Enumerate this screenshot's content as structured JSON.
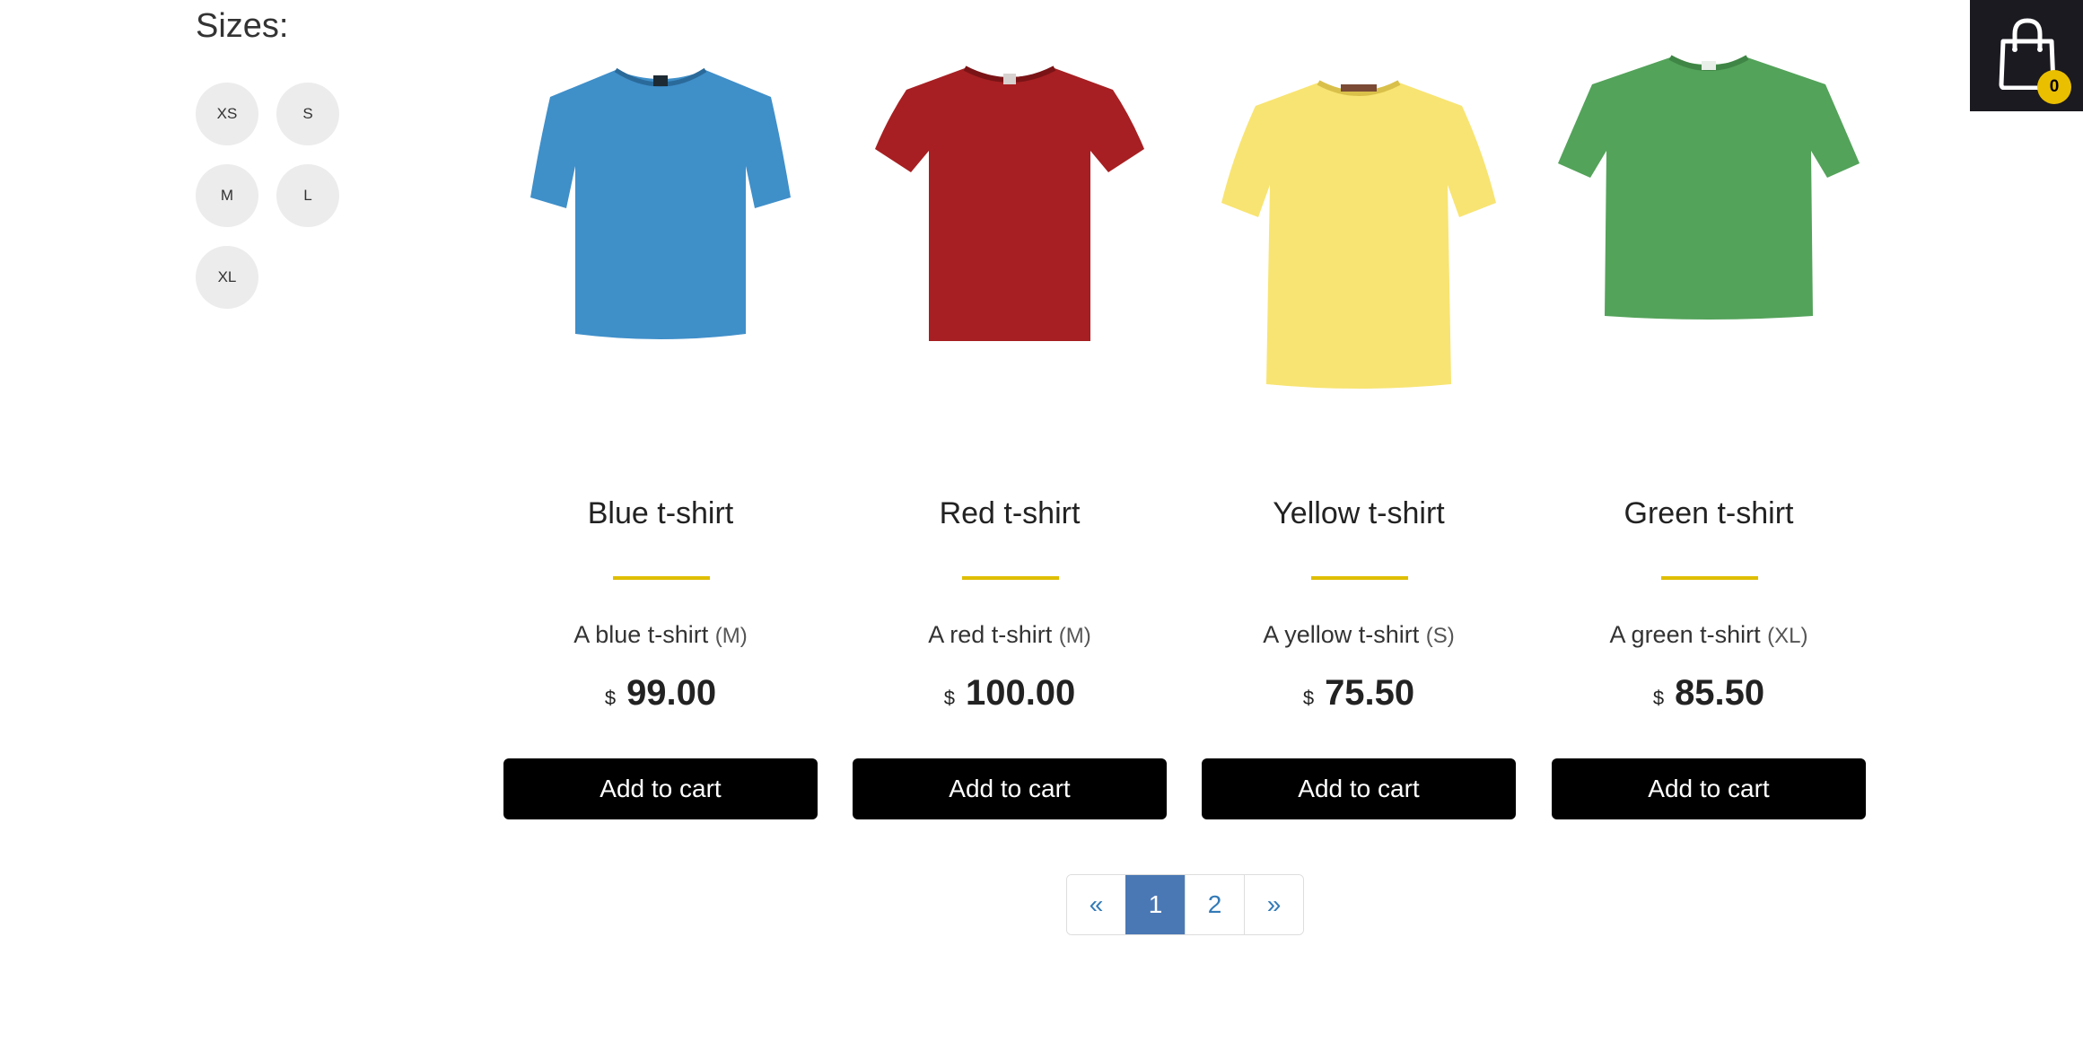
{
  "filters": {
    "title": "Sizes:",
    "sizes": [
      "XS",
      "S",
      "M",
      "L",
      "XL"
    ]
  },
  "products": [
    {
      "name": "Blue t-shirt",
      "description": "A blue t-shirt",
      "size": "(M)",
      "currency": "$",
      "price": "99.00",
      "button": "Add to cart",
      "color": "#3f8fc9",
      "icon": "blue-tshirt-image"
    },
    {
      "name": "Red t-shirt",
      "description": "A red t-shirt",
      "size": "(M)",
      "currency": "$",
      "price": "100.00",
      "button": "Add to cart",
      "color": "#a71f22",
      "icon": "red-tshirt-image"
    },
    {
      "name": "Yellow t-shirt",
      "description": "A yellow t-shirt",
      "size": "(S)",
      "currency": "$",
      "price": "75.50",
      "button": "Add to cart",
      "color": "#f8e472",
      "icon": "yellow-tshirt-image"
    },
    {
      "name": "Green t-shirt",
      "description": "A green t-shirt",
      "size": "(XL)",
      "currency": "$",
      "price": "85.50",
      "button": "Add to cart",
      "color": "#53a35a",
      "icon": "green-tshirt-image"
    }
  ],
  "pagination": {
    "prev": "«",
    "pages": [
      "1",
      "2"
    ],
    "active": "1",
    "next": "»"
  },
  "cart": {
    "count": "0",
    "icon": "shopping-bag-icon"
  },
  "colors": {
    "accent": "#dfbd00",
    "button_bg": "#000000",
    "pagination_active": "#4a78b4",
    "cart_bg": "#1b1a20",
    "badge": "#eabf00"
  }
}
